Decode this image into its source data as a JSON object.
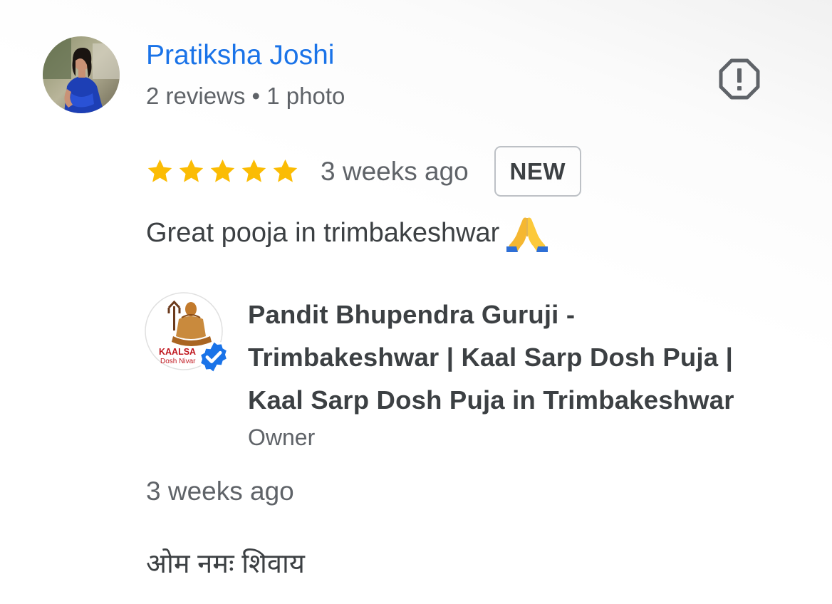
{
  "review": {
    "reviewer": {
      "name": "Pratiksha Joshi",
      "meta": "2 reviews • 1 photo",
      "avatar_icon": "profile-photo"
    },
    "report_icon": "report-flag-icon",
    "rating": {
      "stars": 5,
      "max_stars": 5,
      "star_color": "#fbbc04"
    },
    "time": "3 weeks ago",
    "badge": "NEW",
    "text": "Great pooja in trimbakeshwar",
    "emoji": "folded-hands",
    "owner_response": {
      "name_lines": [
        "Pandit Bhupendra Guruji -",
        "Trimbakeshwar | Kaal Sarp Dosh Puja |",
        "Kaal Sarp Dosh Puja in Trimbakeshwar"
      ],
      "avatar_logo_text": [
        "KAALSA",
        "Dosh Nivar"
      ],
      "verified_icon": "verified-badge-icon",
      "verified_color": "#1a73e8",
      "role": "Owner",
      "time": "3 weeks ago",
      "text": "ओम नमः शिवाय"
    },
    "colors": {
      "name_link": "#1a73e8",
      "secondary_text": "#5f6368",
      "primary_text": "#3c4043"
    }
  }
}
